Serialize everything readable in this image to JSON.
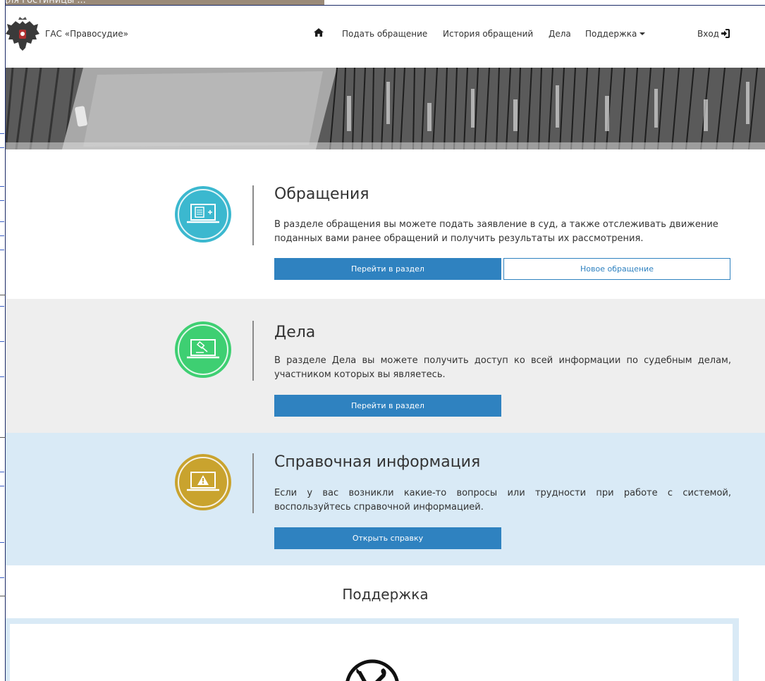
{
  "background_window": {
    "partial_text": "для гостиницы ..."
  },
  "header": {
    "brand": "ГАС «Правосудие»",
    "nav": [
      "Подать обращение",
      "История обращений",
      "Дела",
      "Поддержка"
    ],
    "login": "Вход"
  },
  "sections": [
    {
      "title": "Обращения",
      "text": "В разделе обращения вы можете подать заявление в суд, а также отслеживать движение поданных вами ранее обращений и получить результаты их рассмотрения.",
      "primary_button": "Перейти в раздел",
      "secondary_button": "Новое обращение",
      "color": "#3bb8cf"
    },
    {
      "title": "Дела",
      "text": "В разделе Дела вы можете получить доступ ко всей информации по судебным делам, участником которых вы являетесь.",
      "primary_button": "Перейти в раздел",
      "color": "#3ecf72"
    },
    {
      "title": "Справочная информация",
      "text": "Если у вас возникли какие-то вопросы или трудности при работе с системой, воспользуйтесь справочной информацией.",
      "primary_button": "Открыть справку",
      "color": "#c9a32e"
    }
  ],
  "support": {
    "title": "Поддержка"
  },
  "colors": {
    "primary": "#2f82c0",
    "gray_band": "#eeeeee",
    "blue_band": "#d9eaf6"
  }
}
